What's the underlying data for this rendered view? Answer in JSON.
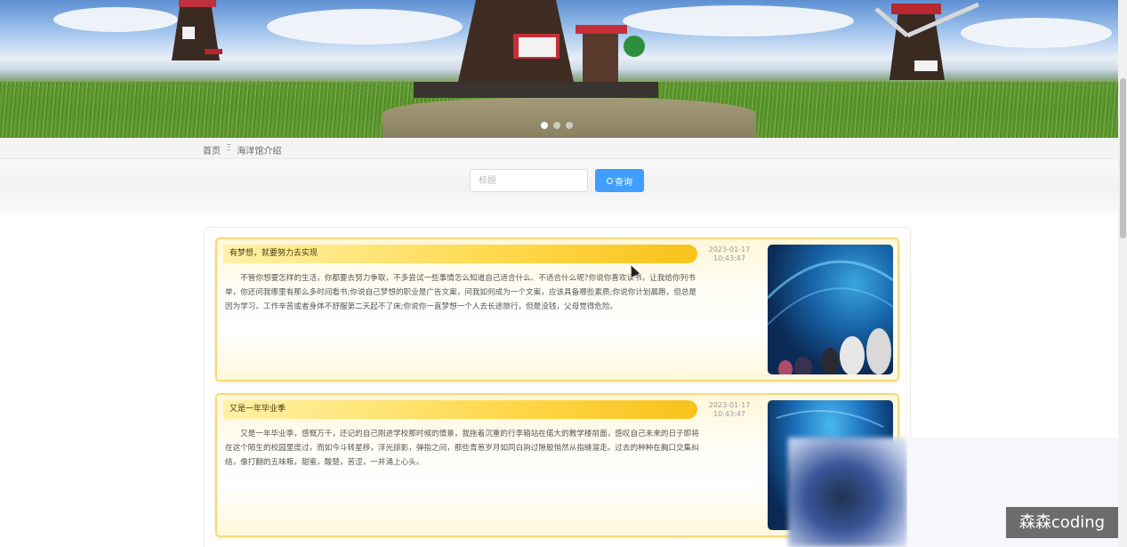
{
  "breadcrumb": {
    "home": "首页",
    "separator": "Ξ",
    "current": "海洋馆介绍"
  },
  "search": {
    "placeholder": "标题",
    "button_label": "查询"
  },
  "carousel": {
    "slide_count": 3,
    "active_index": 0
  },
  "articles": [
    {
      "title": "有梦想，就要努力去实现",
      "date": "2023-01-17",
      "time": "10:43:47",
      "content": "不管你想要怎样的生活，你都要去努力争取，不多尝试一些事情怎么知道自己适合什么、不适合什么呢?你说你喜欢读书，让我给你列书单，你还问我哪里有那么多时间看书;你说自己梦想的职业是广告文案，问我如何成为一个文案，应该具备哪些素质;你说你计划晨跑，但总是因为学习、工作辛苦或者身体不舒服第二天起不了床;你说你一直梦想一个人去长途旅行，但是没钱，父母觉得危险。",
      "image": "aquarium-tunnel-photo"
    },
    {
      "title": "又是一年毕业季",
      "date": "2023-01-17",
      "time": "10:43:47",
      "content": "又是一年毕业季，感慨万千，还记的自己刚进学校那时候的情景，我拖着沉重的行李箱站在偌大的教学楼前面，感叹自己未来的日子即将在这个陌生的校园里度过，而如今斗转星移，浮光掠影，弹指之间，那些青葱岁月如同白驹过隙般悄然从指缝溜走。过去的种种在胸口交集纠结，像打翻的五味瓶，甜蜜，酸楚，苦涩，一并涌上心头。",
      "image": "aquarium-blue-photo"
    }
  ],
  "watermark": "森森coding"
}
